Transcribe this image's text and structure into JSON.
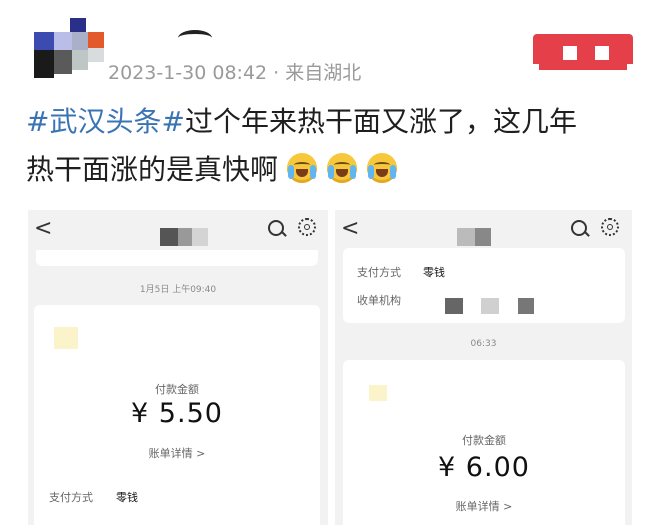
{
  "post": {
    "timestamp": "2023-1-30 08:42",
    "separator": "·",
    "location": "来自湖北",
    "hashtag": "#武汉头条#",
    "text_line1": "过个年来热干面又涨了，这几年",
    "text_line2": "热干面涨的是真快啊",
    "emoji_count": 3,
    "emoji": "crying-laughing-icon"
  },
  "left_screenshot": {
    "back": "<",
    "date": "1月5日 上午09:40",
    "amount_label": "付款金额",
    "amount": "¥ 5.50",
    "details_link": "账单详情 >",
    "pay_method_label": "支付方式",
    "pay_method_value": "零钱"
  },
  "right_screenshot": {
    "back": "<",
    "pay_method_label": "支付方式",
    "pay_method_value": "零钱",
    "merchant_label": "收单机构",
    "time": "06:33",
    "amount_label": "付款金额",
    "amount": "¥ 6.00",
    "details_link": "账单详情 >"
  },
  "colors": {
    "hashtag": "#3a74b5",
    "meta": "#9a9a9a",
    "red_badge": "#e5404a"
  }
}
